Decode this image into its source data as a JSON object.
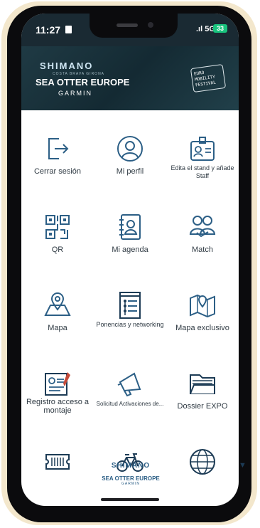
{
  "status": {
    "time": "11:27",
    "network": "5G",
    "battery": "33"
  },
  "banner": {
    "brand": "SHIMANO",
    "tagline": "COSTA BRAVA GIRONA",
    "event": "SEA OTTER EUROPE",
    "sponsor": "GARMIN",
    "badge": "EURO\nMOBILITY\nFESTIVAL"
  },
  "menu": {
    "items": [
      {
        "label": "Cerrar sesión",
        "icon": "logout-icon"
      },
      {
        "label": "Mi perfil",
        "icon": "user-profile-icon"
      },
      {
        "label": "Edita el stand y añade Staff",
        "icon": "id-badge-icon"
      },
      {
        "label": "QR",
        "icon": "qr-code-icon"
      },
      {
        "label": "Mi agenda",
        "icon": "address-book-icon"
      },
      {
        "label": "Match",
        "icon": "people-match-icon"
      },
      {
        "label": "Mapa",
        "icon": "map-pin-icon"
      },
      {
        "label": "Ponencias y networking",
        "icon": "list-document-icon"
      },
      {
        "label": "Mapa exclusivo",
        "icon": "folded-map-icon"
      },
      {
        "label": "Registro acceso a montaje",
        "icon": "registration-form-icon"
      },
      {
        "label": "Solicitud Activaciones de...",
        "icon": "megaphone-icon"
      },
      {
        "label": "Dossier EXPO",
        "icon": "folder-icon"
      },
      {
        "label": "",
        "icon": "ticket-icon"
      },
      {
        "label": "",
        "icon": "bicycle-icon"
      },
      {
        "label": "",
        "icon": "globe-icon"
      }
    ]
  },
  "footer": {
    "brand": "SHIMANO",
    "event": "SEA OTTER EUROPE",
    "sponsor": "GARMIN"
  },
  "scroll_indicator": "▼"
}
